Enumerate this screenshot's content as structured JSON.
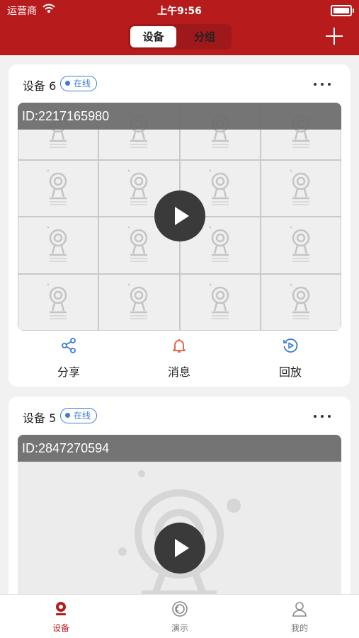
{
  "status_bar": {
    "carrier": "运营商",
    "time": "上午9:56"
  },
  "header": {
    "segments": [
      "设备",
      "分组"
    ],
    "active_segment": "设备"
  },
  "devices": [
    {
      "name": "设备 6",
      "status": "在线",
      "id_text": "ID:2217165980"
    },
    {
      "name": "设备 5",
      "status": "在线",
      "id_text": "ID:2847270594"
    }
  ],
  "card_actions": [
    {
      "label": "分享",
      "icon": "share-icon",
      "color": "#3b7bd6"
    },
    {
      "label": "消息",
      "icon": "bell-icon",
      "color": "#e8573a"
    },
    {
      "label": "回放",
      "icon": "playback-icon",
      "color": "#3b7bd6"
    }
  ],
  "tab_bar": [
    {
      "label": "设备",
      "icon": "device-tab-icon",
      "active": true
    },
    {
      "label": "演示",
      "icon": "demo-tab-icon",
      "active": false
    },
    {
      "label": "我的",
      "icon": "profile-tab-icon",
      "active": false
    }
  ],
  "colors": {
    "brand": "#b71b1c",
    "online": "#3b7bd6",
    "alert": "#e8573a"
  }
}
